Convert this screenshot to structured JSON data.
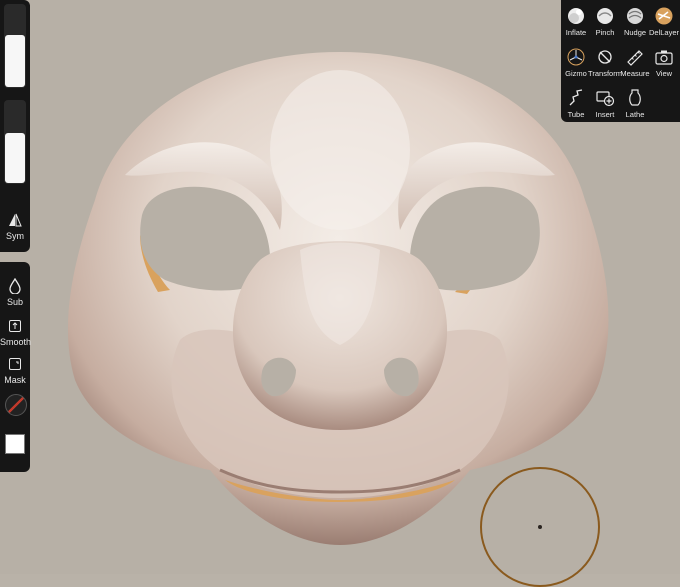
{
  "left_toolbar": {
    "symmetry_label": "Sym",
    "radius_slider_fill": 0.62,
    "intensity_slider_fill": 0.6,
    "sub_label": "Sub",
    "smooth_label": "Smooth",
    "mask_label": "Mask",
    "material_color": "#ffffff"
  },
  "tool_panel": {
    "row1": [
      {
        "label": "Inflate",
        "icon": "inflate-icon"
      },
      {
        "label": "Pinch",
        "icon": "pinch-icon"
      },
      {
        "label": "Nudge",
        "icon": "nudge-icon"
      },
      {
        "label": "DelLayer",
        "icon": "layer-icon"
      }
    ],
    "row2": [
      {
        "label": "Gizmo",
        "icon": "gizmo-icon"
      },
      {
        "label": "Transform",
        "icon": "transform-icon"
      },
      {
        "label": "Measure",
        "icon": "ruler-icon"
      },
      {
        "label": "View",
        "icon": "camera-icon"
      }
    ],
    "row3": [
      {
        "label": "Tube",
        "icon": "tube-icon"
      },
      {
        "label": "Insert",
        "icon": "insert-icon"
      },
      {
        "label": "Lathe",
        "icon": "lathe-icon"
      }
    ]
  },
  "colors": {
    "background": "#b7b0a6",
    "model": "#e7dcd3",
    "accent": "#d9a25e",
    "panel": "#161616"
  }
}
